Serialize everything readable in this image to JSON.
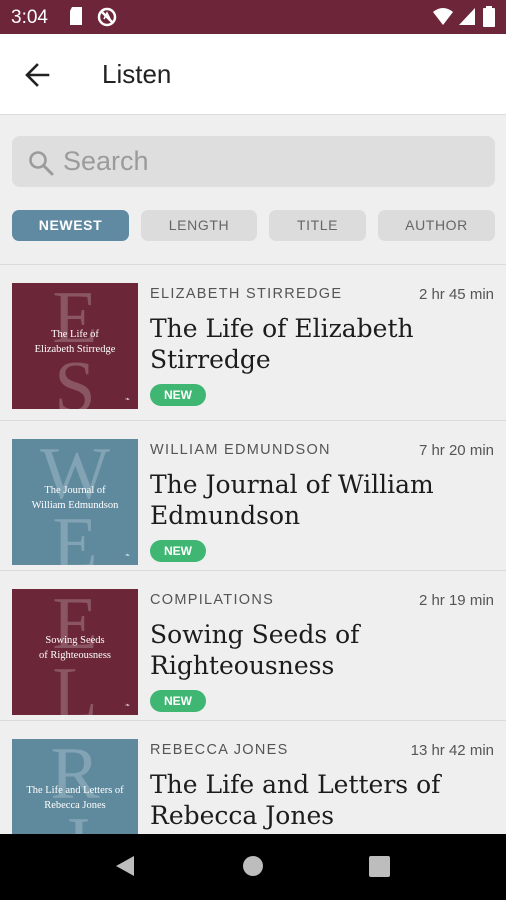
{
  "status_bar": {
    "time": "3:04"
  },
  "header": {
    "title": "Listen"
  },
  "search": {
    "placeholder": "Search"
  },
  "sort_options": [
    "NEWEST",
    "LENGTH",
    "TITLE",
    "AUTHOR"
  ],
  "sort_selected": "NEWEST",
  "books": [
    {
      "author": "ELIZABETH STIRREDGE",
      "duration": "2 hr 45 min",
      "title": "The Life of Elizabeth Stirredge",
      "badge": "NEW",
      "cover_color": "#6b2738",
      "cover_letters": "E\nS",
      "cover_title": "The Life of\nElizabeth Stirredge"
    },
    {
      "author": "WILLIAM EDMUNDSON",
      "duration": "7 hr 20 min",
      "title": "The Journal of William Edmundson",
      "badge": "NEW",
      "cover_color": "#5f8a9e",
      "cover_letters": "W\nE",
      "cover_title": "The Journal of\nWilliam Edmundson"
    },
    {
      "author": "COMPILATIONS",
      "duration": "2 hr 19 min",
      "title": "Sowing Seeds of Righteousness",
      "badge": "NEW",
      "cover_color": "#6b2738",
      "cover_letters": "E\nL",
      "cover_title": "Sowing Seeds\nof Righteousness"
    },
    {
      "author": "REBECCA JONES",
      "duration": "13 hr 42 min",
      "title": "The Life and Letters of Rebecca Jones",
      "badge": "",
      "cover_color": "#5f8a9e",
      "cover_letters": "R\nJ",
      "cover_title": "The Life and Letters of\nRebecca Jones"
    }
  ],
  "colors": {
    "status_bar": "#6d2639",
    "accent": "#5f8aa2",
    "badge": "#3fb773"
  },
  "icons": [
    "sd-card-icon",
    "no-disturb-icon",
    "wifi-icon",
    "signal-icon",
    "battery-icon",
    "back-arrow-icon",
    "search-icon",
    "nav-back-icon",
    "nav-home-icon",
    "nav-recents-icon"
  ]
}
